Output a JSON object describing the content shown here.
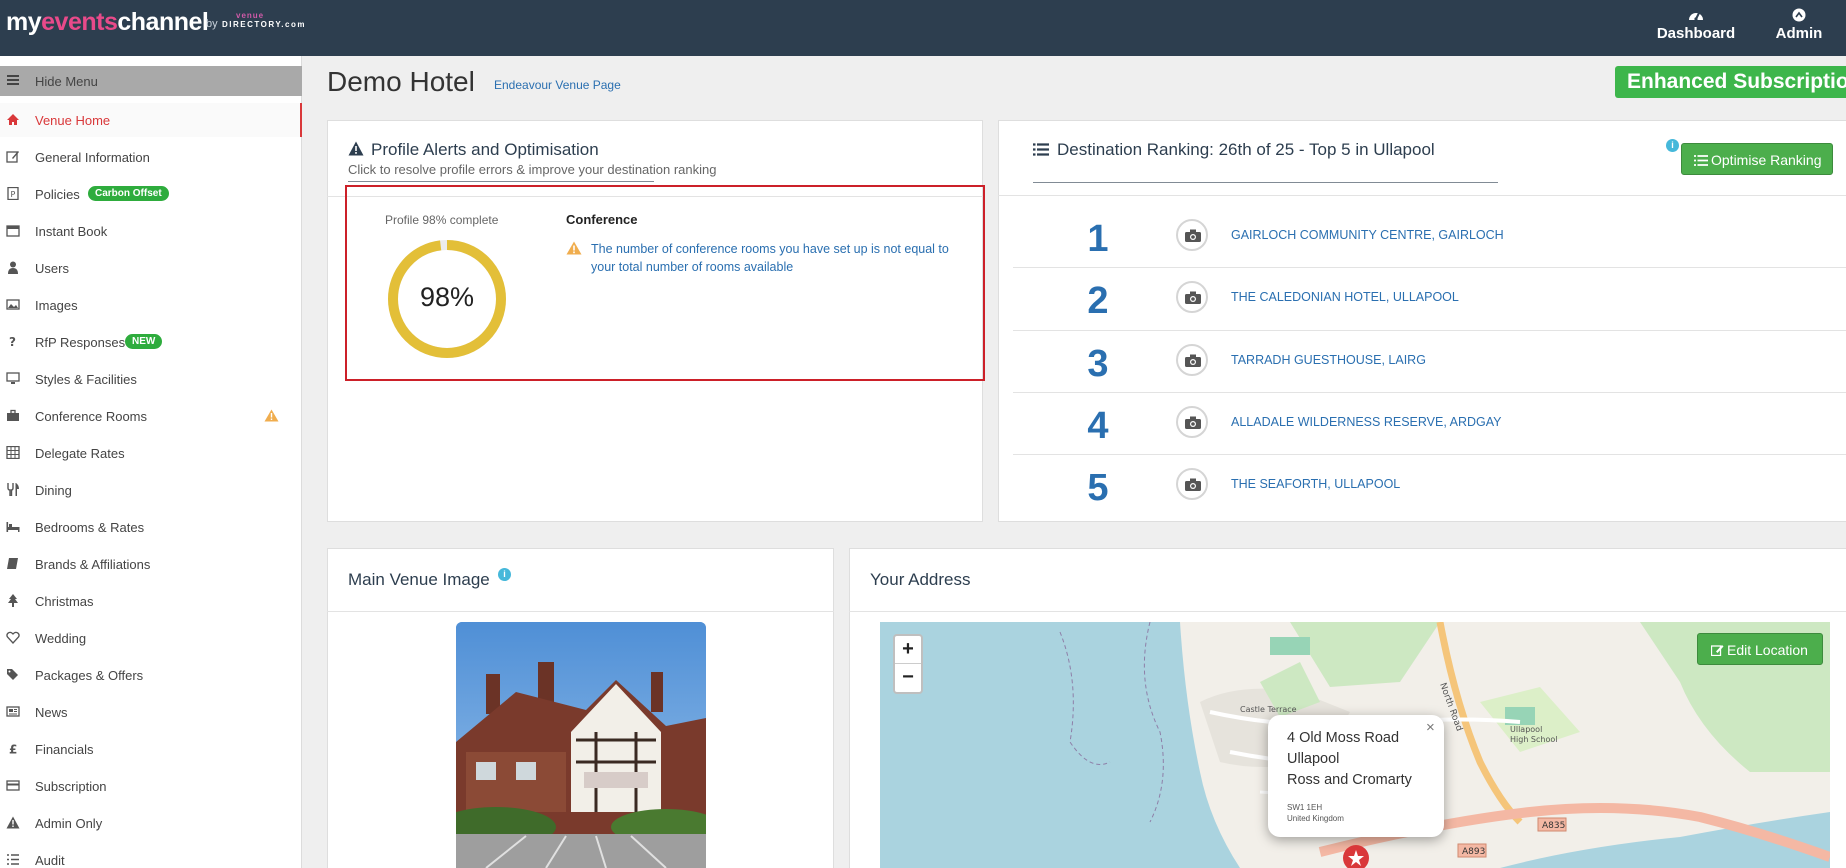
{
  "brand": {
    "part1": "my",
    "part2": "events",
    "part3": "channel",
    "by": "by",
    "venue": "venue",
    "directory": "DIRECTORY.com"
  },
  "topnav": {
    "dashboard": "Dashboard",
    "admin": "Admin"
  },
  "sidebar": {
    "hide_menu": "Hide Menu",
    "items": [
      {
        "label": "Venue Home",
        "icon": "home-icon"
      },
      {
        "label": "General Information",
        "icon": "edit-icon"
      },
      {
        "label": "Policies",
        "icon": "document-icon",
        "badge": "Carbon Offset"
      },
      {
        "label": "Instant Book",
        "icon": "calendar-icon"
      },
      {
        "label": "Users",
        "icon": "user-icon"
      },
      {
        "label": "Images",
        "icon": "image-icon"
      },
      {
        "label": "RfP Responses",
        "icon": "question-icon",
        "badge": "NEW"
      },
      {
        "label": "Styles & Facilities",
        "icon": "monitor-icon"
      },
      {
        "label": "Conference Rooms",
        "icon": "briefcase-icon",
        "warning": true
      },
      {
        "label": "Delegate Rates",
        "icon": "calculator-icon"
      },
      {
        "label": "Dining",
        "icon": "cutlery-icon"
      },
      {
        "label": "Bedrooms & Rates",
        "icon": "bed-icon"
      },
      {
        "label": "Brands & Affiliations",
        "icon": "book-icon"
      },
      {
        "label": "Christmas",
        "icon": "tree-icon"
      },
      {
        "label": "Wedding",
        "icon": "heart-icon"
      },
      {
        "label": "Packages & Offers",
        "icon": "tags-icon"
      },
      {
        "label": "News",
        "icon": "newspaper-icon"
      },
      {
        "label": "Financials",
        "icon": "pound-icon"
      },
      {
        "label": "Subscription",
        "icon": "card-icon"
      },
      {
        "label": "Admin Only",
        "icon": "warning-icon"
      },
      {
        "label": "Audit",
        "icon": "list-icon"
      }
    ]
  },
  "header": {
    "title": "Demo Hotel",
    "link": "Endeavour Venue Page",
    "subscription": "Enhanced Subscription"
  },
  "alerts": {
    "title": "Profile Alerts and Optimisation",
    "subtitle": "Click to resolve profile errors & improve your destination ranking",
    "progress_label": "Profile 98% complete",
    "progress": 98,
    "progress_text": "98%",
    "section": "Conference",
    "message": "The number of conference rooms you have set up is not equal to your total number of rooms available"
  },
  "ranking": {
    "title": "Destination Ranking: 26th of 25 - Top 5 in Ullapool",
    "button": "Optimise Ranking",
    "info": "i",
    "rows": [
      {
        "rank": "1",
        "name": "GAIRLOCH COMMUNITY CENTRE, GAIRLOCH"
      },
      {
        "rank": "2",
        "name": "THE CALEDONIAN HOTEL, ULLAPOOL"
      },
      {
        "rank": "3",
        "name": "TARRADH GUESTHOUSE, LAIRG"
      },
      {
        "rank": "4",
        "name": "ALLADALE WILDERNESS RESERVE, ARDGAY"
      },
      {
        "rank": "5",
        "name": "THE SEAFORTH, ULLAPOOL"
      }
    ]
  },
  "main_image": {
    "title": "Main Venue Image",
    "info": "i"
  },
  "address": {
    "title": "Your Address",
    "edit_button": "Edit Location",
    "zoom_in": "+",
    "zoom_out": "−",
    "close": "×",
    "lines": [
      "4 Old Moss Road",
      "Ullapool",
      "Ross and Cromarty"
    ],
    "postcode": "SW1 1EH",
    "country": "United Kingdom"
  },
  "colors": {
    "topbar": "#2d3e4f",
    "accent_red": "#d9383a",
    "link_blue": "#2a6fb0",
    "green": "#4cae4c",
    "donut": "#e3bf38"
  }
}
